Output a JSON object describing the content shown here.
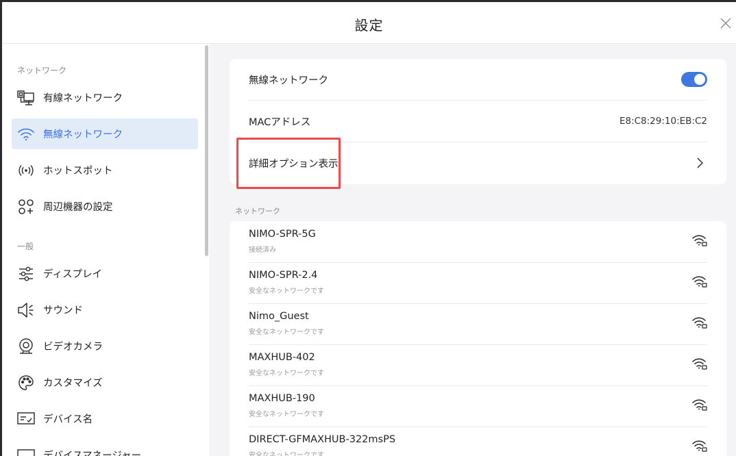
{
  "window": {
    "title": "設定"
  },
  "sidebar": {
    "sections": [
      {
        "label": "ネットワーク"
      },
      {
        "label": "一般"
      }
    ],
    "items": [
      {
        "label": "有線ネットワーク",
        "icon": "wired-network-icon"
      },
      {
        "label": "無線ネットワーク",
        "icon": "wifi-icon",
        "active": true
      },
      {
        "label": "ホットスポット",
        "icon": "hotspot-icon"
      },
      {
        "label": "周辺機器の設定",
        "icon": "peripherals-icon"
      },
      {
        "label": "ディスプレイ",
        "icon": "sliders-icon"
      },
      {
        "label": "サウンド",
        "icon": "speaker-icon"
      },
      {
        "label": "ビデオカメラ",
        "icon": "webcam-icon"
      },
      {
        "label": "カスタマイズ",
        "icon": "palette-icon"
      },
      {
        "label": "デバイス名",
        "icon": "device-name-icon"
      },
      {
        "label": "デバイスマネージャー",
        "icon": "device-manager-icon"
      }
    ]
  },
  "wireless": {
    "toggle_label": "無線ネットワーク",
    "toggle_on": true,
    "mac_label": "MACアドレス",
    "mac_value": "E8:C8:29:10:EB:C2",
    "advanced_label": "詳細オプション表示"
  },
  "networks": {
    "section_label": "ネットワーク",
    "items": [
      {
        "name": "NIMO-SPR-5G",
        "status": "接続済み"
      },
      {
        "name": "NIMO-SPR-2.4",
        "status": "安全なネットワークです"
      },
      {
        "name": "Nimo_Guest",
        "status": "安全なネットワークです"
      },
      {
        "name": "MAXHUB-402",
        "status": "安全なネットワークです"
      },
      {
        "name": "MAXHUB-190",
        "status": "安全なネットワークです"
      },
      {
        "name": "DIRECT-GFMAXHUB-322msPS",
        "status": "安全なネットワークです"
      }
    ]
  },
  "colors": {
    "accent": "#3d78e0",
    "highlight": "#e84b4b",
    "active_bg": "#e2ecf9"
  }
}
